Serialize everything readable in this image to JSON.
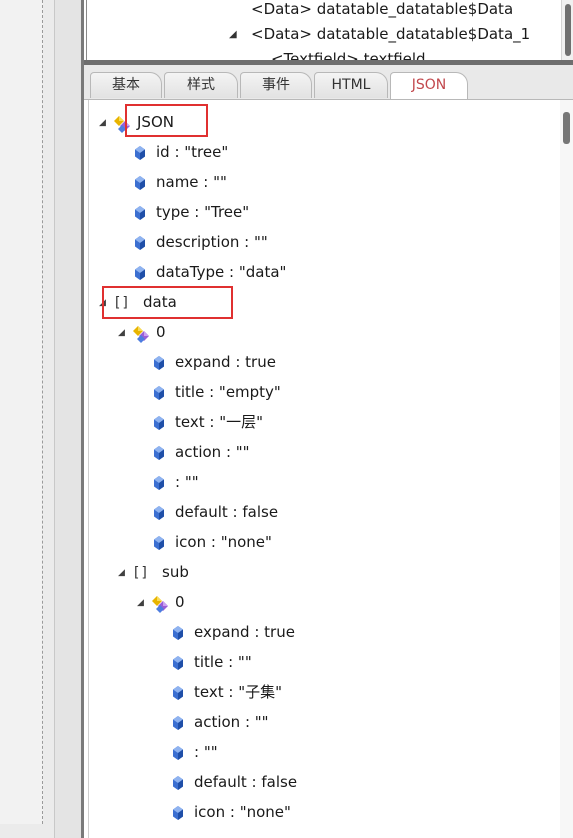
{
  "top_tree": {
    "rows": [
      {
        "text": "<Data> datatable_datatable$Data"
      },
      {
        "text": "<Data> datatable_datatable$Data_1",
        "expander": "◢"
      },
      {
        "text": "<Textfield> textfield"
      }
    ]
  },
  "tabs": [
    {
      "label": "基本"
    },
    {
      "label": "样式"
    },
    {
      "label": "事件"
    },
    {
      "label": "HTML"
    },
    {
      "label": "JSON"
    }
  ],
  "json_tree": [
    {
      "label": "JSON",
      "type": "object",
      "expander": "◢"
    },
    {
      "label": "id : \"tree\"",
      "type": "prop"
    },
    {
      "label": "name : \"\"",
      "type": "prop"
    },
    {
      "label": "type : \"Tree\"",
      "type": "prop"
    },
    {
      "label": "description : \"\"",
      "type": "prop"
    },
    {
      "label": "dataType : \"data\"",
      "type": "prop"
    },
    {
      "label": "data",
      "type": "array",
      "expander": "◢"
    },
    {
      "label": "0",
      "type": "object",
      "expander": "◢"
    },
    {
      "label": "expand : true",
      "type": "prop"
    },
    {
      "label": "title : \"empty\"",
      "type": "prop"
    },
    {
      "label": "text : \"一层\"",
      "type": "prop"
    },
    {
      "label": "action : \"\"",
      "type": "prop"
    },
    {
      "label": ": \"\"",
      "type": "prop"
    },
    {
      "label": "default : false",
      "type": "prop"
    },
    {
      "label": "icon : \"none\"",
      "type": "prop"
    },
    {
      "label": "sub",
      "type": "array",
      "expander": "◢"
    },
    {
      "label": "0",
      "type": "object",
      "expander": "◢"
    },
    {
      "label": "expand : true",
      "type": "prop"
    },
    {
      "label": "title : \"\"",
      "type": "prop"
    },
    {
      "label": "text : \"子集\"",
      "type": "prop"
    },
    {
      "label": "action : \"\"",
      "type": "prop"
    },
    {
      "label": ": \"\"",
      "type": "prop"
    },
    {
      "label": "default : false",
      "type": "prop"
    },
    {
      "label": "icon : \"none\"",
      "type": "prop"
    }
  ],
  "colors": {
    "highlight": "#e03030",
    "active_tab_text": "#c2484d",
    "prop_icon": "#3b6fd1"
  }
}
